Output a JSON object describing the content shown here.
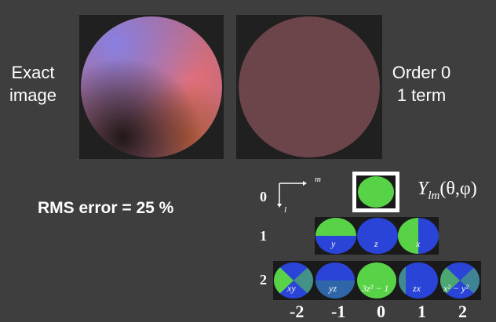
{
  "left_caption": {
    "line1": "Exact",
    "line2": "image"
  },
  "right_caption": {
    "line1": "Order 0",
    "line2": "1 term"
  },
  "rms_text": "RMS error = 25 %",
  "axes": {
    "m_label": "m",
    "l_label": "l"
  },
  "y_function": {
    "symbol": "Y",
    "subscript": "lm",
    "args": "(θ,φ)"
  },
  "rows": [
    {
      "l": "0",
      "labels": []
    },
    {
      "l": "1",
      "labels": [
        "y",
        "z",
        "x"
      ]
    },
    {
      "l": "2",
      "labels": [
        "xy",
        "yz",
        "3z² − 1",
        "zx",
        "x² − y²"
      ]
    }
  ],
  "m_values": [
    "-2",
    "-1",
    "0",
    "1",
    "2"
  ],
  "colors": {
    "background": "#3e3e3e",
    "panel": "#202020",
    "order0_sphere": "#6b4549",
    "harmonic_green": "#58d246",
    "harmonic_blue": "#2a44d8",
    "highlight_border": "#ffffff"
  }
}
